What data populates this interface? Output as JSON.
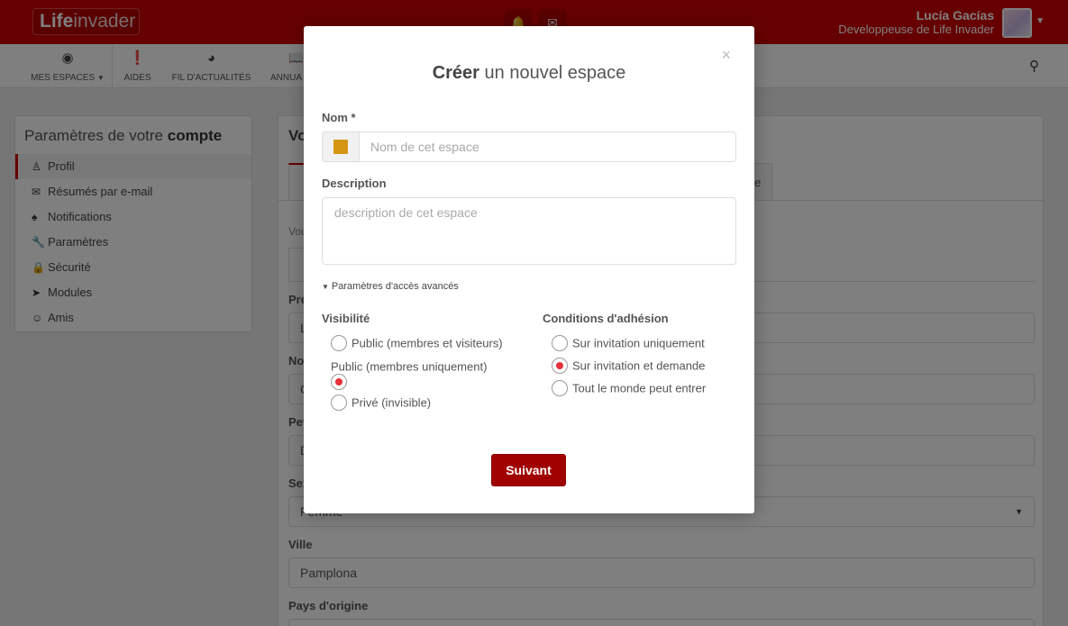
{
  "topbar": {
    "logo_bold": "Life",
    "logo_light": "invader",
    "user_name": "Lucía Gacías",
    "user_role": "Developpeuse de Life Invader"
  },
  "nav": {
    "items": [
      {
        "label": "MES ESPACES",
        "icon": "target-icon"
      },
      {
        "label": "AIDES",
        "icon": "exclamation-circle-icon"
      },
      {
        "label": "FIL D'ACTUALITÉS",
        "icon": "dashboard-icon"
      },
      {
        "label": "ANNUA",
        "icon": "book-icon"
      }
    ]
  },
  "sidebar": {
    "title_light": "Paramètres de votre",
    "title_bold": "compte",
    "items": [
      {
        "label": "Profil",
        "icon": "user-icon"
      },
      {
        "label": "Résumés par e-mail",
        "icon": "envelope-icon"
      },
      {
        "label": "Notifications",
        "icon": "bell-icon"
      },
      {
        "label": "Paramètres",
        "icon": "wrench-icon"
      },
      {
        "label": "Sécurité",
        "icon": "lock-icon"
      },
      {
        "label": "Modules",
        "icon": "rocket-icon"
      },
      {
        "label": "Amis",
        "icon": "users-icon"
      }
    ]
  },
  "main": {
    "title_visible": "Vo",
    "tab_visible_end": "e",
    "intro_visible": "Vou",
    "labels": {
      "first_name": "Pré",
      "last_name": "Nor",
      "nickname": "Pet",
      "gender": "Sex",
      "city": "Ville",
      "country": "Pays d'origine"
    },
    "values": {
      "first_name": "L",
      "last_name": "G",
      "nickname": "D",
      "gender": "Femme",
      "city": "Pamplona"
    }
  },
  "modal": {
    "title_bold": "Créer",
    "title_light": "un nouvel espace",
    "close": "×",
    "name_label": "Nom *",
    "name_placeholder": "Nom de cet espace",
    "space_color": "#d49512",
    "description_label": "Description",
    "description_placeholder": "description de cet espace",
    "advanced_link": "Paramètres d'accès avancés",
    "visibility": {
      "label": "Visibilité",
      "options": [
        {
          "label": "Public (membres et visiteurs)",
          "checked": false
        },
        {
          "label": "Public (membres uniquement)",
          "checked": true
        },
        {
          "label": "Privé (invisible)",
          "checked": false
        }
      ]
    },
    "join": {
      "label": "Conditions d'adhésion",
      "options": [
        {
          "label": "Sur invitation uniquement",
          "checked": false
        },
        {
          "label": "Sur invitation et demande",
          "checked": true
        },
        {
          "label": "Tout le monde peut entrer",
          "checked": false
        }
      ]
    },
    "next_button": "Suivant"
  },
  "colors": {
    "brand_red": "#cc0000",
    "button_red": "#a10000",
    "radio_checked": "#e8303a"
  }
}
